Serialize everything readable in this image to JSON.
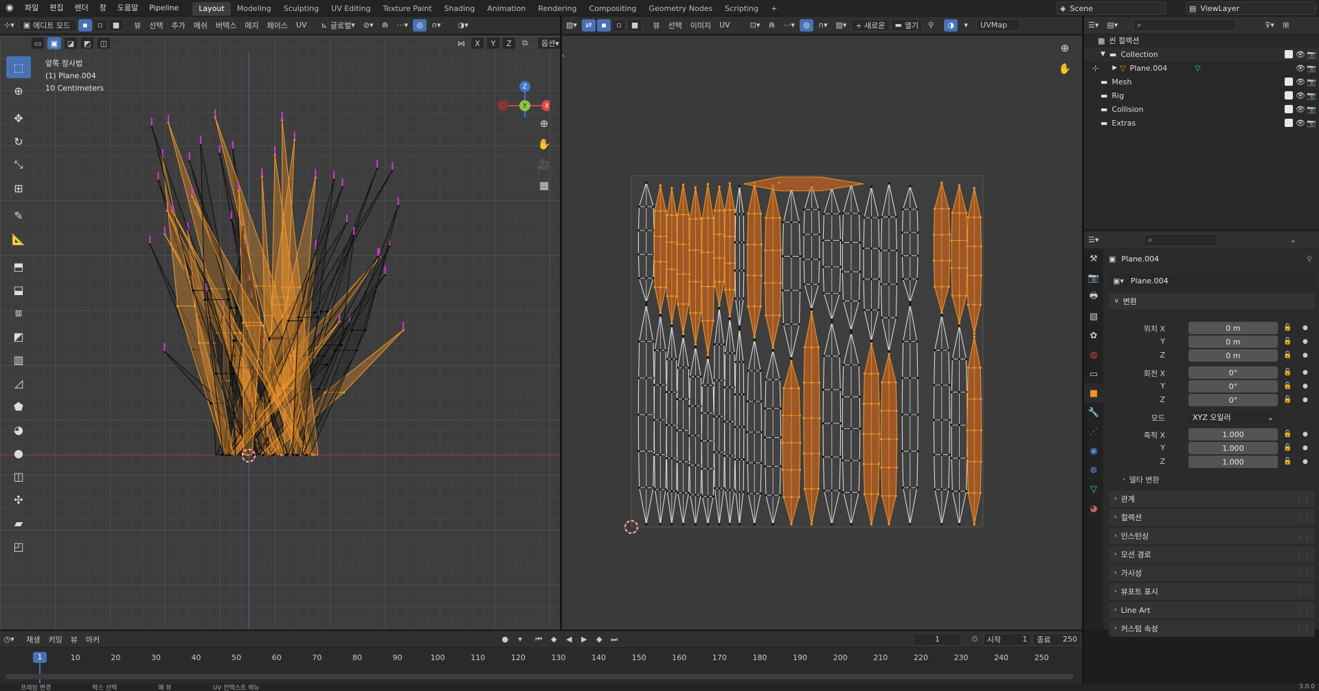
{
  "topbar": {
    "menus": [
      "파일",
      "편집",
      "렌더",
      "창",
      "도움말",
      "Pipeline"
    ],
    "workspaces": [
      "Layout",
      "Modeling",
      "Sculpting",
      "UV Editing",
      "Texture Paint",
      "Shading",
      "Animation",
      "Rendering",
      "Compositing",
      "Geometry Nodes",
      "Scripting",
      "+"
    ],
    "active_workspace": "Layout",
    "scene": "Scene",
    "view_layer": "ViewLayer"
  },
  "viewport3d": {
    "mode": "에디트 모드",
    "menus": [
      "뷰",
      "선택",
      "추가",
      "메쉬",
      "버텍스",
      "에지",
      "페이스",
      "UV"
    ],
    "orientation": "글로벌",
    "options": "옵션",
    "axes": [
      "X",
      "Y",
      "Z"
    ],
    "info": {
      "view": "앞쪽 정사법",
      "object": "(1) Plane.004",
      "scale": "10 Centimeters"
    },
    "gizmo": {
      "x": "X",
      "y": "Y",
      "z": "Z"
    }
  },
  "uv_editor": {
    "menus": [
      "뷰",
      "선택",
      "이미지",
      "UV"
    ],
    "new_label": "+ 새로운",
    "open_label": "열기",
    "uvmap": "UVMap"
  },
  "outliner": {
    "root": "씬 컬렉션",
    "items": [
      {
        "name": "Collection"
      },
      {
        "name": "Plane.004"
      },
      {
        "name": "Mesh"
      },
      {
        "name": "Rig"
      },
      {
        "name": "Collision"
      },
      {
        "name": "Extras"
      }
    ]
  },
  "properties": {
    "object_name": "Plane.004",
    "datablock": "Plane.004",
    "transform_label": "변환",
    "location_label": "위치",
    "rotation_label": "회전",
    "mode_label": "모드",
    "scale_label": "축척",
    "axis": {
      "x": "X",
      "y": "Y",
      "z": "Z"
    },
    "location": {
      "x": "0 m",
      "y": "0 m",
      "z": "0 m"
    },
    "rotation": {
      "x": "0°",
      "y": "0°",
      "z": "0°"
    },
    "rotation_mode": "XYZ 오일러",
    "scale": {
      "x": "1.000",
      "y": "1.000",
      "z": "1.000"
    },
    "delta": "델타 변환",
    "panels": [
      "관계",
      "컬렉션",
      "인스턴싱",
      "모션 경로",
      "가시성",
      "뷰포트 표시",
      "Line Art",
      "커스텀 속성"
    ]
  },
  "timeline": {
    "menus": [
      "재생",
      "키잉",
      "뷰",
      "마커"
    ],
    "current_frame": "1",
    "start_label": "시작",
    "start": "1",
    "end_label": "종료",
    "end": "250",
    "ruler": [
      "1",
      "10",
      "20",
      "30",
      "40",
      "50",
      "60",
      "70",
      "80",
      "90",
      "100",
      "110",
      "120",
      "130",
      "140",
      "150",
      "160",
      "170",
      "180",
      "190",
      "200",
      "210",
      "220",
      "230",
      "240",
      "250"
    ]
  },
  "statusbar": {
    "items": [
      "프레임 변경",
      "박스 선택",
      "패 뷰",
      "UV 컨텍스트 메뉴"
    ],
    "version": "3.0.0"
  },
  "colors": {
    "accent": "#4772b3",
    "selected": "#f0952a",
    "background": "#3d3d3d"
  }
}
